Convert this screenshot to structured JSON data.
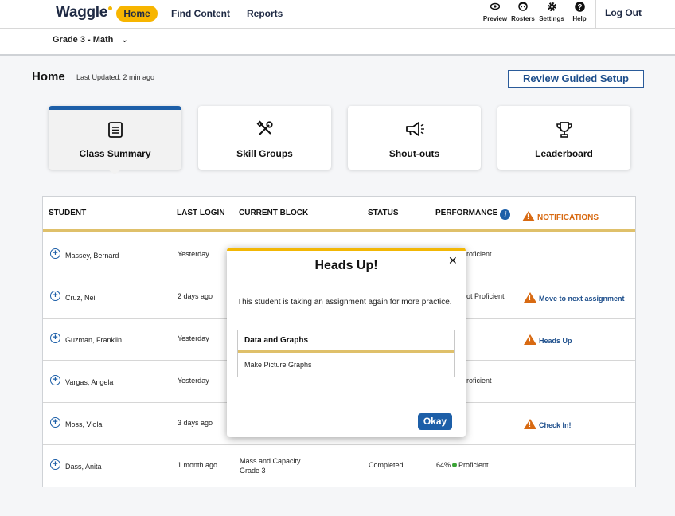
{
  "brand": {
    "logo": "Waggle",
    "accent": "#f7b500",
    "primary": "#1d5fa8",
    "warning": "#d86a12"
  },
  "nav": {
    "home": "Home",
    "find_content": "Find Content",
    "reports": "Reports",
    "tools": [
      {
        "label": "Preview",
        "icon": "eye-icon"
      },
      {
        "label": "Rosters",
        "icon": "face-icon"
      },
      {
        "label": "Settings",
        "icon": "gear-icon"
      },
      {
        "label": "Help",
        "icon": "help-icon"
      }
    ],
    "logout": "Log Out"
  },
  "grade": {
    "selected": "Grade 3 - Math"
  },
  "page": {
    "title": "Home",
    "last_updated": "Last Updated: 2 min ago",
    "guided_setup": "Review Guided Setup"
  },
  "cards": [
    {
      "label": "Class Summary",
      "icon": "list-icon",
      "active": true
    },
    {
      "label": "Skill Groups",
      "icon": "tools-icon",
      "active": false
    },
    {
      "label": "Shout-outs",
      "icon": "megaphone-icon",
      "active": false
    },
    {
      "label": "Leaderboard",
      "icon": "trophy-icon",
      "active": false
    }
  ],
  "table": {
    "headers": {
      "student": "STUDENT",
      "last_login": "LAST LOGIN",
      "current_block": "CURRENT BLOCK",
      "status": "STATUS",
      "performance": "PERFORMANCE",
      "notifications": "NOTIFICATIONS"
    },
    "rows": [
      {
        "name": "Massey, Bernard",
        "login": "Yesterday",
        "block": "",
        "block_sub": "",
        "status": "",
        "perf_pct": "",
        "perf_label": "roficient",
        "notification": ""
      },
      {
        "name": "Cruz, Neil",
        "login": "2 days ago",
        "block": "",
        "block_sub": "",
        "status": "",
        "perf_pct": "",
        "perf_label": "ot Proficient",
        "notification": "Move to next assignment"
      },
      {
        "name": "Guzman, Franklin",
        "login": "Yesterday",
        "block": "",
        "block_sub": "",
        "status": "",
        "perf_pct": "",
        "perf_label": "",
        "notification": "Heads Up"
      },
      {
        "name": "Vargas, Angela",
        "login": "Yesterday",
        "block": "",
        "block_sub": "",
        "status": "",
        "perf_pct": "",
        "perf_label": "roficient",
        "notification": ""
      },
      {
        "name": "Moss, Viola",
        "login": "3 days ago",
        "block": "",
        "block_sub": "",
        "status": "",
        "perf_pct": "",
        "perf_label": "",
        "notification": "Check In!"
      },
      {
        "name": "Dass, Anita",
        "login": "1 month ago",
        "block": "Mass and Capacity",
        "block_sub": "Grade 3",
        "status": "Completed",
        "perf_pct": "64%",
        "perf_label": "Proficient",
        "notification": ""
      }
    ]
  },
  "modal": {
    "title": "Heads Up!",
    "close": "✕",
    "message": "This student is taking an assignment again for more practice.",
    "box_header": "Data and Graphs",
    "box_item": "Make Picture Graphs",
    "ok": "Okay"
  }
}
